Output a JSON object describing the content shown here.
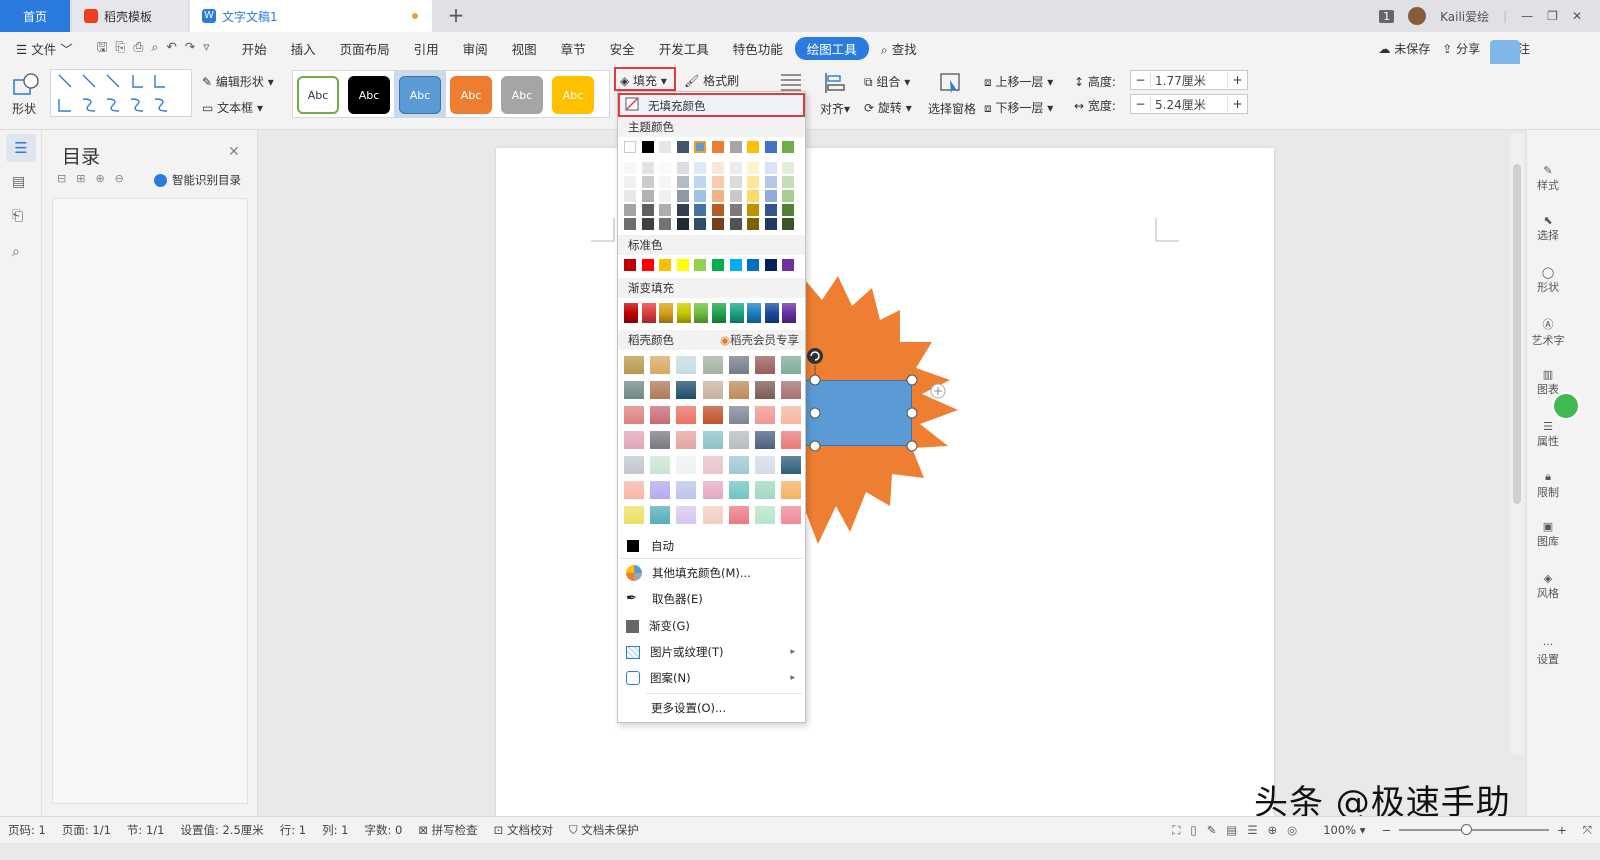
{
  "tabs": {
    "home": "首页",
    "daoke": "稻壳模板",
    "doc": "文字文稿1",
    "add": "+"
  },
  "window": {
    "page_badge": "1",
    "user": "Kaili爱绘"
  },
  "menu": {
    "file": "文件",
    "items": [
      "开始",
      "插入",
      "页面布局",
      "引用",
      "审阅",
      "视图",
      "章节",
      "安全",
      "开发工具",
      "特色功能",
      "绘图工具",
      "查找"
    ],
    "unsaved": "未保存",
    "share": "分享",
    "comment": "批注"
  },
  "ribbon": {
    "shape": "形状",
    "edit_shape": "编辑形状",
    "textbox": "文本框",
    "style_label": "Abc",
    "fill": "填充",
    "format_brush": "格式刷",
    "align": "对齐",
    "group": "组合",
    "rotate": "旋转",
    "select_pane": "选择窗格",
    "bring_forward": "上移一层",
    "send_backward": "下移一层",
    "height_label": "高度:",
    "height_value": "1.77厘米",
    "width_label": "宽度:",
    "width_value": "5.24厘米",
    "minus": "−",
    "plus": "+"
  },
  "toc": {
    "title": "目录",
    "smart": "智能识别目录"
  },
  "dropdown": {
    "no_fill": "无填充颜色",
    "theme_colors": "主题颜色",
    "standard_colors": "标准色",
    "gradient_fill": "渐变填充",
    "daoke_colors": "稻壳颜色",
    "member_only": "稻壳会员专享",
    "auto": "自动",
    "more_colors": "其他填充颜色(M)...",
    "eyedropper": "取色器(E)",
    "gradient": "渐变(G)",
    "picture_texture": "图片或纹理(T)",
    "pattern": "图案(N)",
    "more_settings": "更多设置(O)..."
  },
  "rightrail": [
    "样式",
    "选择",
    "形状",
    "艺术字",
    "图表",
    "属性",
    "限制",
    "图库",
    "风格",
    "设置"
  ],
  "status": {
    "page": "页码: 1",
    "pages": "页面: 1/1",
    "section": "节: 1/1",
    "setting": "设置值: 2.5厘米",
    "row": "行: 1",
    "col": "列: 1",
    "words": "字数: 0",
    "spell": "拼写检查",
    "proof": "文档校对",
    "protect": "文档未保护",
    "zoom": "100%"
  },
  "watermark": "头条 @极速手助",
  "colors": {
    "accent": "#2b7bde",
    "shape_orange": "#ee7e32",
    "rect_blue": "#5b9bd5",
    "highlight": "#e03a3a",
    "theme_top": [
      "#ffffff",
      "#000000",
      "#e7e6e6",
      "#44546a",
      "#5b9bd5",
      "#ed7d31",
      "#a5a5a5",
      "#ffc000",
      "#4472c4",
      "#70ad47"
    ],
    "standard": [
      "#c00000",
      "#ff0000",
      "#ffc000",
      "#ffff00",
      "#92d050",
      "#00b050",
      "#00b0f0",
      "#0070c0",
      "#002060",
      "#7030a0"
    ],
    "gradient": [
      "#c00000",
      "#e03a3a",
      "#d4a017",
      "#c8c800",
      "#6cbf3c",
      "#1fa34a",
      "#1aa386",
      "#1a7fc1",
      "#1a4a9c",
      "#6a2fa0"
    ]
  }
}
